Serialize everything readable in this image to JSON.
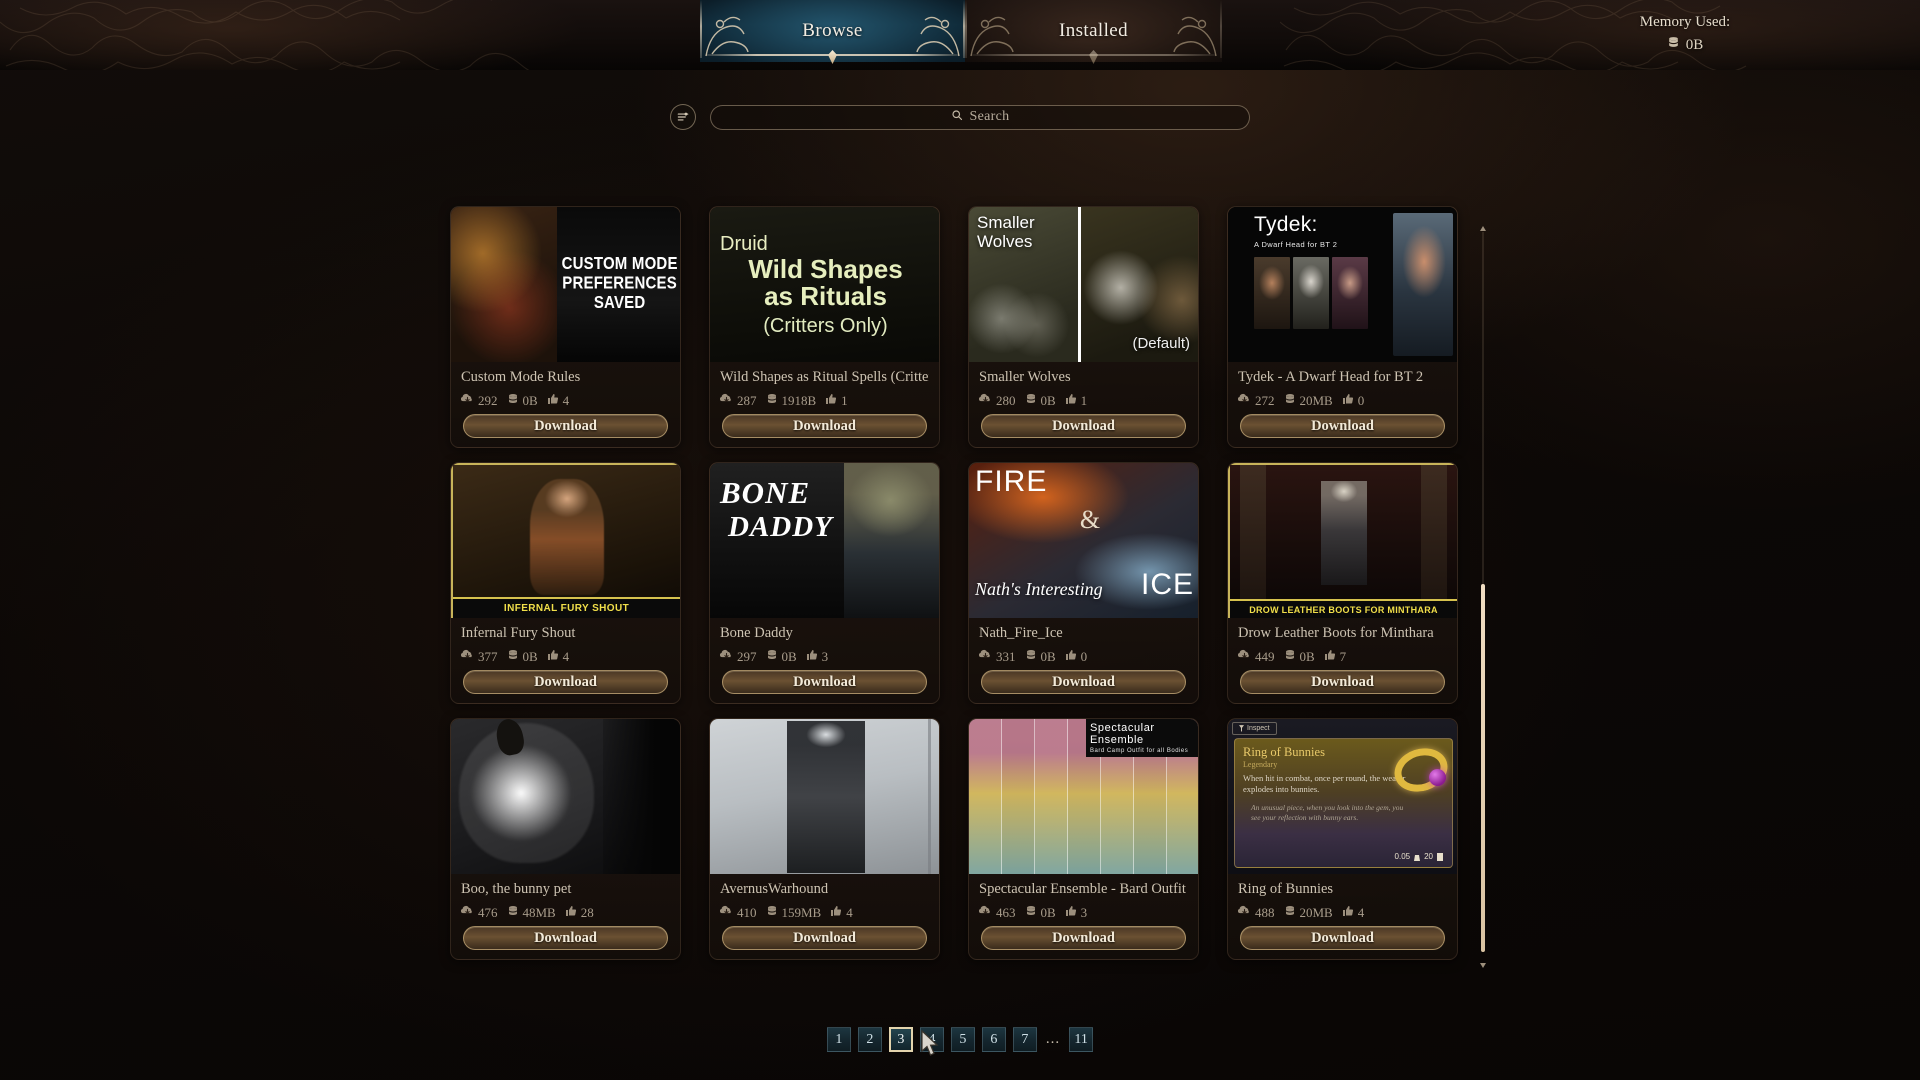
{
  "topbar": {
    "tabs": [
      {
        "label": "Browse",
        "active": true
      },
      {
        "label": "Installed",
        "active": false
      }
    ],
    "memory": {
      "label": "Memory Used:",
      "value": "0B",
      "icon": "database-icon"
    }
  },
  "search": {
    "placeholder": "Search",
    "value": "",
    "search_icon": "search-icon",
    "filter_icon": "filter-sort-icon"
  },
  "grid": {
    "download_label": "Download",
    "stat_icons": {
      "downloads": "cloud-download-icon",
      "size": "database-icon",
      "likes": "thumbs-up-icon"
    },
    "cards": [
      {
        "title": "Custom Mode Rules",
        "downloads": "292",
        "size": "0B",
        "likes": "4",
        "thumb_style": "t1",
        "art_text": [
          "CUSTOM MODE",
          "PREFERENCES",
          "SAVED"
        ]
      },
      {
        "title": "Wild Shapes as Ritual Spells (Critters O.",
        "downloads": "287",
        "size": "1918B",
        "likes": "1",
        "thumb_style": "t2",
        "art_text": [
          "Druid",
          "Wild Shapes",
          "as Rituals",
          "(Critters Only)"
        ]
      },
      {
        "title": "Smaller Wolves",
        "downloads": "280",
        "size": "0B",
        "likes": "1",
        "thumb_style": "t3",
        "art_text": [
          "Smaller\nWolves",
          "(Default)"
        ]
      },
      {
        "title": "Tydek - A Dwarf Head for BT 2",
        "downloads": "272",
        "size": "20MB",
        "likes": "0",
        "thumb_style": "t4",
        "art_text": [
          "Tydek:",
          "A Dwarf Head for BT 2"
        ]
      },
      {
        "title": "Infernal Fury Shout",
        "downloads": "377",
        "size": "0B",
        "likes": "4",
        "thumb_style": "t5",
        "art_text": [
          "INFERNAL FURY SHOUT"
        ]
      },
      {
        "title": "Bone Daddy",
        "downloads": "297",
        "size": "0B",
        "likes": "3",
        "thumb_style": "t6",
        "art_text": [
          "BONE",
          "DADDY"
        ]
      },
      {
        "title": "Nath_Fire_Ice",
        "downloads": "331",
        "size": "0B",
        "likes": "0",
        "thumb_style": "t7",
        "art_text": [
          "FIRE",
          "&",
          "ICE",
          "Nath's Interesting"
        ]
      },
      {
        "title": "Drow Leather Boots for Minthara",
        "downloads": "449",
        "size": "0B",
        "likes": "7",
        "thumb_style": "t8",
        "art_text": [
          "DROW LEATHER BOOTS FOR MINTHARA"
        ]
      },
      {
        "title": "Boo, the bunny pet",
        "downloads": "476",
        "size": "48MB",
        "likes": "28",
        "thumb_style": "t9",
        "art_text": []
      },
      {
        "title": "AvernusWarhound",
        "downloads": "410",
        "size": "159MB",
        "likes": "4",
        "thumb_style": "t10",
        "art_text": []
      },
      {
        "title": "Spectacular Ensemble - Bard Outfit for..",
        "downloads": "463",
        "size": "0B",
        "likes": "3",
        "thumb_style": "t11",
        "art_text": [
          "Spectacular Ensemble",
          "Bard Camp Outfit for all Bodies"
        ]
      },
      {
        "title": "Ring of Bunnies",
        "downloads": "488",
        "size": "20MB",
        "likes": "4",
        "thumb_style": "t12",
        "art_text": [
          "Inspect",
          "Ring of Bunnies",
          "Legendary",
          "When hit in combat, once per round, the wearer explodes into bunnies.",
          "An unusual piece, when you look into the gem, you see your reflection with bunny ears.",
          "0.05",
          "20"
        ]
      }
    ]
  },
  "pagination": {
    "pages": [
      "1",
      "2",
      "3",
      "4",
      "5",
      "6",
      "7"
    ],
    "ellipsis": "...",
    "last_page": "11",
    "active_page": "3"
  }
}
